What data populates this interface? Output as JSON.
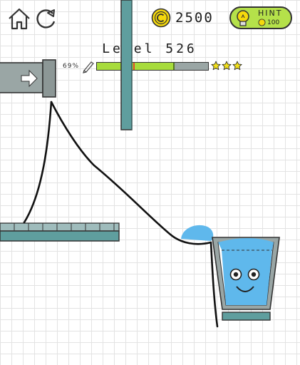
{
  "hud": {
    "home_icon": "home-icon",
    "restart_icon": "restart-icon",
    "coins": "2500",
    "coin_icon": "coin-icon",
    "hint": {
      "label": "HINT",
      "cost": "100",
      "icon": "lightbulb-icon"
    }
  },
  "level": {
    "title": "Level 526",
    "ink_percent_label": "69%",
    "ink_remaining": 0.69,
    "star_thresholds": [
      0.33,
      0.69
    ],
    "stars_filled": 3,
    "pencil_icon": "pencil-icon"
  },
  "colors": {
    "ink_fill": "#a7dc3c",
    "star": "#f2e01a",
    "water": "#5fb8ec",
    "platform": "#5f9e9e",
    "hint_bg": "#b5e14a",
    "coin": "#f5d90c"
  }
}
